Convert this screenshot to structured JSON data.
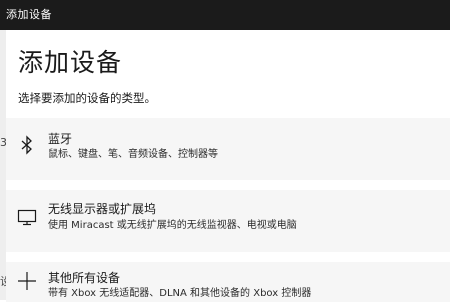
{
  "window": {
    "title": "添加设备"
  },
  "background": {
    "left_fragments": [
      "3",
      "设"
    ]
  },
  "dialog": {
    "heading": "添加设备",
    "subtitle": "选择要添加的设备的类型。",
    "options": [
      {
        "icon": "bluetooth-icon",
        "name": "蓝牙",
        "description": "鼠标、键盘、笔、音频设备、控制器等"
      },
      {
        "icon": "monitor-icon",
        "name": "无线显示器或扩展坞",
        "description": "使用 Miracast 或无线扩展坞的无线监视器、电视或电脑"
      },
      {
        "icon": "plus-icon",
        "name": "其他所有设备",
        "description": "带有 Xbox 无线适配器、DLNA 和其他设备的 Xbox 控制器"
      }
    ]
  },
  "colors": {
    "titlebar": "#1b1b1b",
    "option_background": "#f6f6f6",
    "text": "#1a1a1a"
  }
}
